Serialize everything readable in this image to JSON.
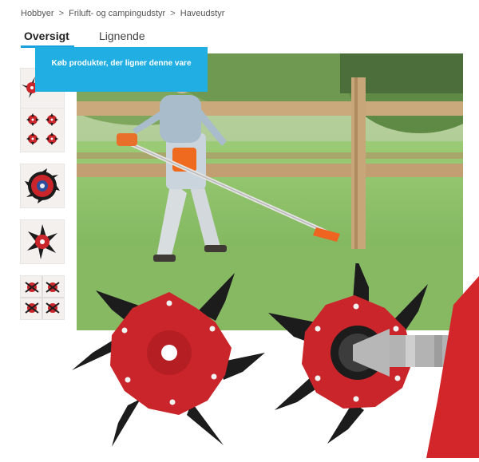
{
  "breadcrumb": {
    "items": [
      "Hobbyer",
      "Friluft- og campingudstyr",
      "Haveudstyr"
    ],
    "separator": ">"
  },
  "tabs": [
    {
      "label": "Oversigt",
      "active": true
    },
    {
      "label": "Lignende",
      "active": false
    }
  ],
  "tooltip": {
    "text": "Køb produkter, der ligner denne vare"
  },
  "thumbnails": [
    {
      "icon": "red-blade-partial-icon"
    },
    {
      "icon": "blade-variants-grid-icon"
    },
    {
      "icon": "red-blade-round-icon"
    },
    {
      "icon": "red-star-blade-icon"
    },
    {
      "icon": "blade-installation-grid-icon"
    }
  ],
  "colors": {
    "accent": "#21aee3",
    "tab_underline": "#1aa0dc",
    "blade_red": "#c9252b",
    "blade_black": "#1c1c1c"
  }
}
